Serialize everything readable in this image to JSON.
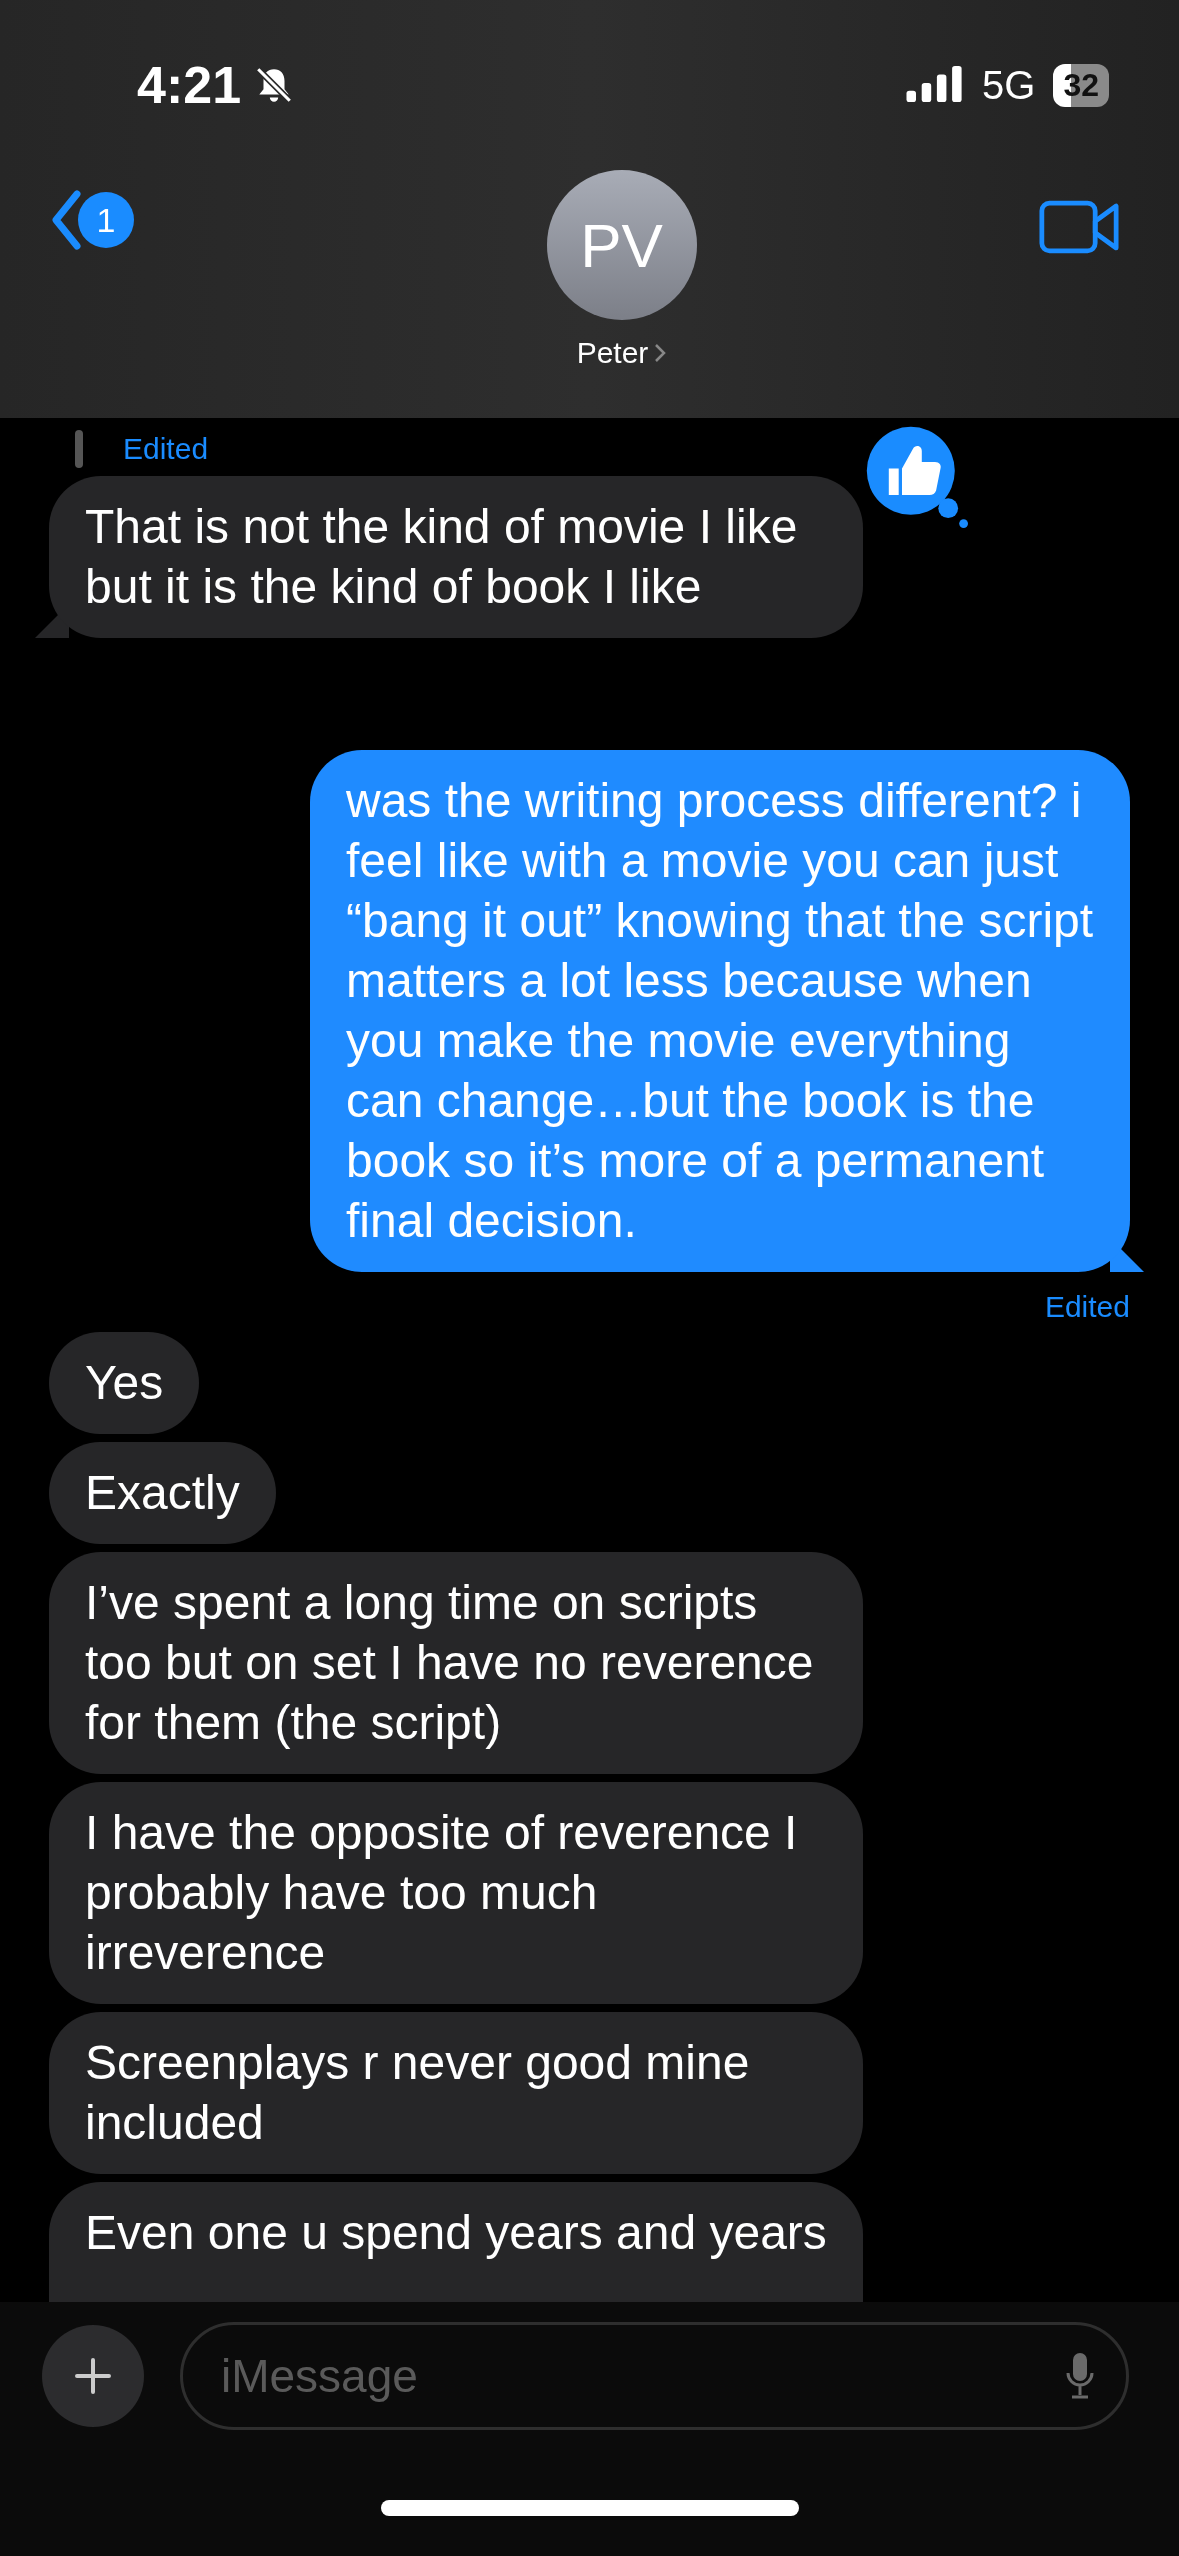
{
  "status_bar": {
    "time": "4:21",
    "network": "5G",
    "battery": "32"
  },
  "header": {
    "back_badge": "1",
    "avatar_initials": "PV",
    "contact_name": "Peter"
  },
  "messages": [
    {
      "kind": "edited",
      "outgoing": false,
      "text": "Edited"
    },
    {
      "kind": "message",
      "outgoing": false,
      "text": "That is not the kind of movie I like but it is the kind of book I like",
      "tail": true,
      "liked": true
    },
    {
      "kind": "message",
      "outgoing": true,
      "text": "was the writing process different? i feel like with a movie you can just “bang it out” knowing that the script matters a lot less because when you make the movie everything can change…but the book is the book so it’s more of a permanent final decision.",
      "tail": true
    },
    {
      "kind": "edited",
      "outgoing": true,
      "text": "Edited"
    },
    {
      "kind": "message",
      "outgoing": false,
      "text": "Yes",
      "tail": false
    },
    {
      "kind": "message",
      "outgoing": false,
      "text": "Exactly",
      "tail": false
    },
    {
      "kind": "message",
      "outgoing": false,
      "text": "I’ve spent a long time on scripts too but on set I have no reverence for them (the script)",
      "tail": false
    },
    {
      "kind": "message",
      "outgoing": false,
      "text": "I have the opposite of reverence  I probably have too much irreverence",
      "tail": false
    },
    {
      "kind": "message",
      "outgoing": false,
      "text": "Screenplays r never good mine included",
      "tail": false
    },
    {
      "kind": "message",
      "outgoing": false,
      "text": "Even one u spend years and years",
      "tail": false,
      "cut_off": true
    }
  ],
  "composer": {
    "placeholder": "iMessage"
  }
}
